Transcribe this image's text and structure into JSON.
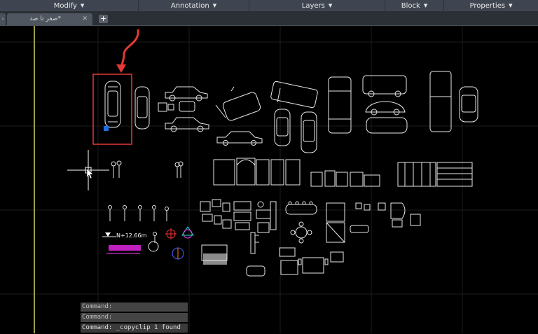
{
  "ribbon": {
    "panels": [
      {
        "label": "Modify"
      },
      {
        "label": "Annotation"
      },
      {
        "label": "Layers"
      },
      {
        "label": "Block"
      },
      {
        "label": "Properties"
      }
    ]
  },
  "tabs": {
    "document_title": "صفر تا صد*",
    "close_glyph": "✕",
    "add_glyph": "+",
    "start_glyph": "›"
  },
  "drawing": {
    "elevation_label": "N+12.66m",
    "highlight_color": "#e53935",
    "grip_color": "#1e6fe0",
    "ucs_line_color": "#d8d060"
  },
  "command": {
    "history": [
      "Command:",
      "Command:"
    ],
    "current": "Command: _copyclip 1 found"
  }
}
